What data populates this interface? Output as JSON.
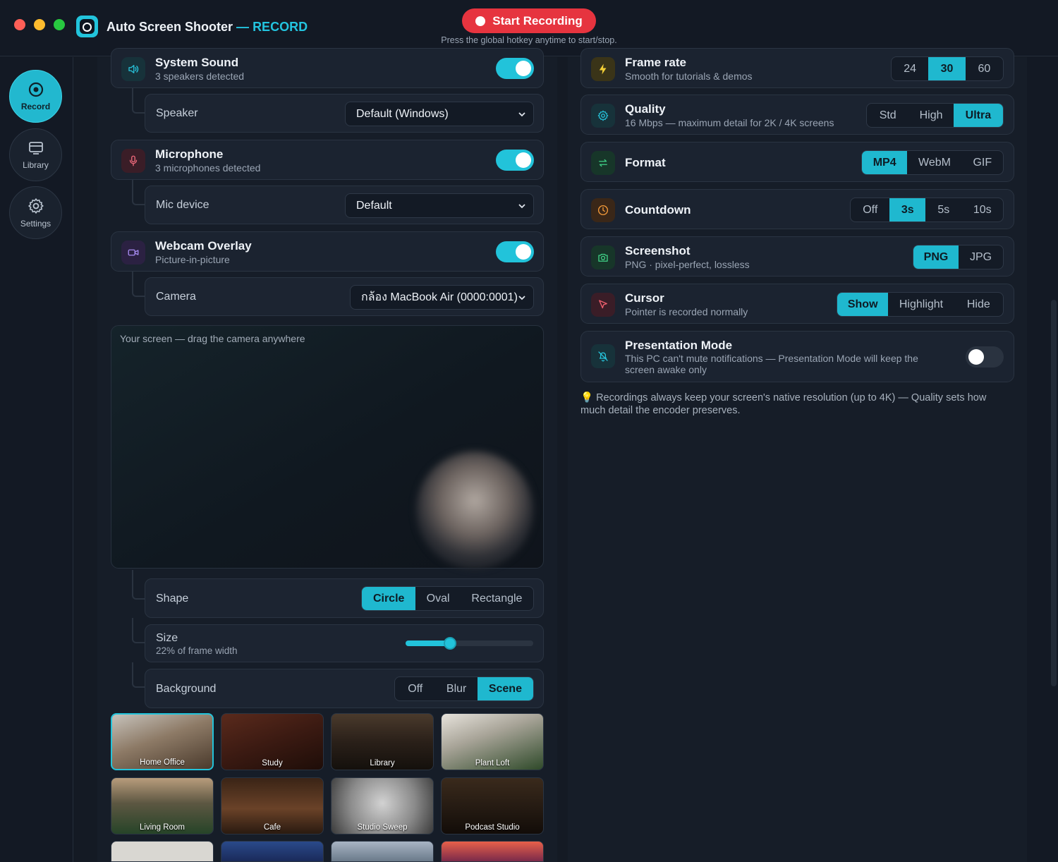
{
  "window": {
    "title": "Auto Screen Shooter",
    "mode": "RECORD",
    "dash": "—"
  },
  "colors": {
    "accent": "#22c3da",
    "record_red": "#e6343f",
    "close": "#fe5f57",
    "minimize": "#febc2e",
    "maximize": "#28c840"
  },
  "header": {
    "record_button": "Start Recording",
    "hint": "Press the global hotkey anytime to start/stop."
  },
  "sidebar": {
    "items": [
      {
        "label": "Record",
        "icon": "record-icon",
        "active": true
      },
      {
        "label": "Library",
        "icon": "library-icon",
        "active": false
      },
      {
        "label": "Settings",
        "icon": "gear-icon",
        "active": false
      }
    ]
  },
  "audio": {
    "system_sound": {
      "title": "System Sound",
      "subtitle": "3 speakers detected",
      "enabled": true,
      "icon": "speaker-icon",
      "device_label": "Speaker",
      "device_value": "Default (Windows)"
    },
    "microphone": {
      "title": "Microphone",
      "subtitle": "3 microphones detected",
      "enabled": true,
      "icon": "mic-icon",
      "device_label": "Mic device",
      "device_value": "Default"
    }
  },
  "webcam": {
    "title": "Webcam Overlay",
    "subtitle": "Picture-in-picture",
    "enabled": true,
    "icon": "video-camera-icon",
    "camera_label": "Camera",
    "camera_value": "กล้อง MacBook Air (0000:0001)",
    "preview_text": "Your screen — drag the camera anywhere",
    "shape": {
      "label": "Shape",
      "options": [
        "Circle",
        "Oval",
        "Rectangle"
      ],
      "selected": "Circle"
    },
    "size": {
      "label": "Size",
      "subtitle": "22% of frame width",
      "fraction": 0.35
    },
    "background": {
      "label": "Background",
      "options": [
        "Off",
        "Blur",
        "Scene"
      ],
      "selected": "Scene"
    },
    "scenes": [
      "Home Office",
      "Study",
      "Library",
      "Plant Loft",
      "Living Room",
      "Cafe",
      "Studio Sweep",
      "Podcast Studio"
    ],
    "selected_scene": "Home Office"
  },
  "settings": {
    "frame_rate": {
      "title": "Frame rate",
      "subtitle": "Smooth for tutorials & demos",
      "options": [
        "24",
        "30",
        "60"
      ],
      "selected": "30"
    },
    "quality": {
      "title": "Quality",
      "subtitle": "16 Mbps — maximum detail for 2K / 4K screens",
      "options": [
        "Std",
        "High",
        "Ultra"
      ],
      "selected": "Ultra"
    },
    "format": {
      "title": "Format",
      "options": [
        "MP4",
        "WebM",
        "GIF"
      ],
      "selected": "MP4"
    },
    "countdown": {
      "title": "Countdown",
      "options": [
        "Off",
        "3s",
        "5s",
        "10s"
      ],
      "selected": "3s"
    },
    "screenshot": {
      "title": "Screenshot",
      "subtitle": "PNG · pixel-perfect, lossless",
      "options": [
        "PNG",
        "JPG"
      ],
      "selected": "PNG"
    },
    "cursor": {
      "title": "Cursor",
      "subtitle": "Pointer is recorded normally",
      "options": [
        "Show",
        "Highlight",
        "Hide"
      ],
      "selected": "Show"
    },
    "presentation": {
      "title": "Presentation Mode",
      "subtitle": "This PC can't mute notifications — Presentation Mode will keep the screen awake only",
      "enabled": false
    }
  },
  "tip": "💡 Recordings always keep your screen's native resolution (up to 4K) — Quality sets how much detail the encoder preserves."
}
